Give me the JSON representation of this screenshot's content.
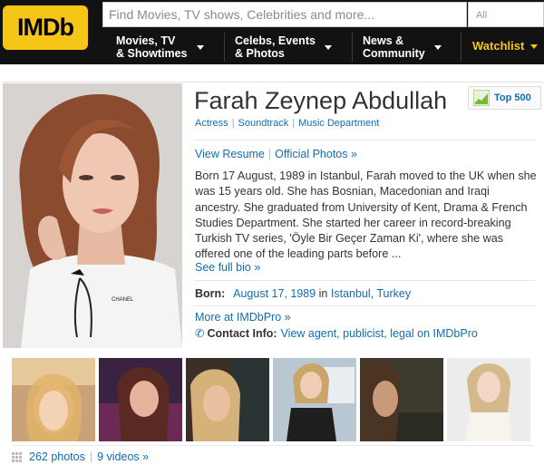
{
  "header": {
    "logo": "IMDb",
    "search_placeholder": "Find Movies, TV shows, Celebrities and more...",
    "search_category": "All",
    "nav": [
      {
        "label": "Movies, TV\n& Showtimes"
      },
      {
        "label": "Celebs, Events\n& Photos"
      },
      {
        "label": "News &\nCommunity"
      }
    ],
    "watchlist": "Watchlist"
  },
  "profile": {
    "name": "Farah Zeynep Abdullah",
    "badge": "Top 500",
    "jobs": [
      "Actress",
      "Soundtrack",
      "Music Department"
    ],
    "link_resume": "View Resume",
    "link_photos": "Official Photos »",
    "bio": "Born 17 August, 1989 in Istanbul, Farah moved to the UK when she was 15 years old. She has Bosnian, Macedonian and Iraqi ancestry. She graduated from University of Kent, Drama & French Studies Department. She started her career in record-breaking Turkish TV series, 'Öyle Bir Geçer Zaman Ki', where she was offered one of the leading parts before ...",
    "see_full_bio": "See full bio »",
    "born_label": "Born:",
    "born_date": "August 17, 1989",
    "born_in": "in",
    "born_place": "Istanbul, Turkey",
    "more_pro": "More at IMDbPro »",
    "contact_label": "Contact Info:",
    "contact_link": "View agent, publicist, legal on IMDbPro",
    "shirt_text": "CHANEL"
  },
  "media": {
    "photos": "262 photos",
    "videos": "9 videos »"
  },
  "colors": {
    "brand_yellow": "#f5c518",
    "header_bg": "#121212",
    "link_blue": "#136cb2"
  }
}
